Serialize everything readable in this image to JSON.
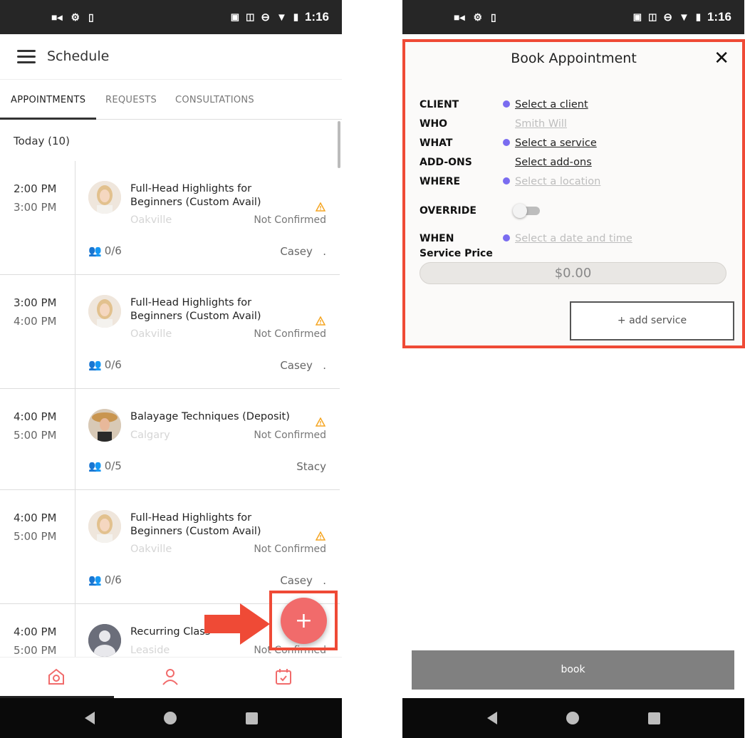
{
  "status_bar": {
    "time": "1:16"
  },
  "left": {
    "title": "Schedule",
    "tabs": [
      {
        "label": "APPOINTMENTS",
        "active": true
      },
      {
        "label": "REQUESTS",
        "active": false
      },
      {
        "label": "CONSULTATIONS",
        "active": false
      }
    ],
    "today_label": "Today (10)",
    "appointments": [
      {
        "start": "2:00 PM",
        "end": "3:00 PM",
        "service": "Full-Head Highlights for Beginners (Custom Avail)",
        "location": "Oakville",
        "status": "Not Confirmed",
        "capacity": "0/6",
        "staff": "Casey",
        "more": "."
      },
      {
        "start": "3:00 PM",
        "end": "4:00 PM",
        "service": "Full-Head Highlights for Beginners (Custom Avail)",
        "location": "Oakville",
        "status": "Not Confirmed",
        "capacity": "0/6",
        "staff": "Casey",
        "more": "."
      },
      {
        "start": "4:00 PM",
        "end": "5:00 PM",
        "service": "Balayage Techniques (Deposit)",
        "location": "Calgary",
        "status": "Not Confirmed",
        "capacity": "0/5",
        "staff": "Stacy",
        "more": ""
      },
      {
        "start": "4:00 PM",
        "end": "5:00 PM",
        "service": "Full-Head Highlights for Beginners (Custom Avail)",
        "location": "Oakville",
        "status": "Not Confirmed",
        "capacity": "0/6",
        "staff": "Casey",
        "more": "."
      },
      {
        "start": "4:00 PM",
        "end": "5:00 PM",
        "service": "Recurring Class",
        "location": "Leaside",
        "status": "Not Confirmed",
        "capacity": "",
        "staff": "",
        "more": ""
      }
    ],
    "fab_label": "+",
    "bottom_nav_icons": [
      "home-icon",
      "profile-icon",
      "calendar-icon"
    ],
    "colors": {
      "accent": "#f16b6b",
      "highlight": "#ef4a36"
    }
  },
  "right": {
    "modal_title": "Book Appointment",
    "close_label": "✕",
    "rows": {
      "client": {
        "label": "CLIENT",
        "value": "Select a client"
      },
      "who": {
        "label": "WHO",
        "value": "Smith Will"
      },
      "what": {
        "label": "WHAT",
        "value": "Select a service"
      },
      "addons": {
        "label": "ADD-ONS",
        "value": "Select add-ons"
      },
      "where": {
        "label": "WHERE",
        "value": "Select a location"
      },
      "override": {
        "label": "OVERRIDE",
        "on": false
      },
      "when": {
        "label": "WHEN",
        "value": "Select a date and time"
      },
      "price": {
        "label": "Service Price",
        "value": "$0.00"
      }
    },
    "add_service_label": "+ add service",
    "book_label": "book",
    "colors": {
      "required_dot": "#7a6cf0"
    }
  }
}
